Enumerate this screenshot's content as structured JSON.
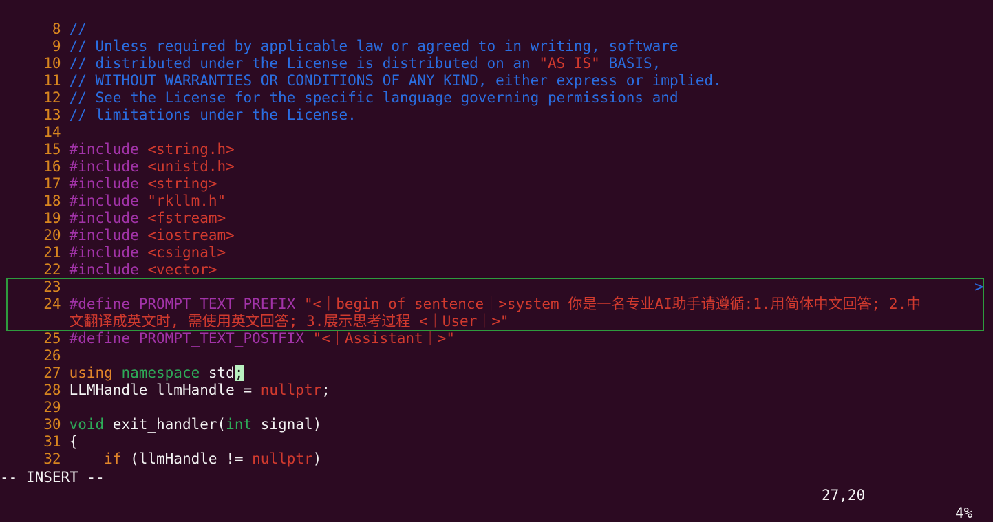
{
  "lines": [
    {
      "num": "8",
      "comment": "//"
    },
    {
      "num": "9",
      "comment": "// Unless required by applicable law or agreed to in writing, software"
    },
    {
      "num": "10",
      "comment_a": "// distributed under the License is distributed on an ",
      "comment_str": "\"AS IS\"",
      "comment_b": " BASIS,"
    },
    {
      "num": "11",
      "comment": "// WITHOUT WARRANTIES OR CONDITIONS OF ANY KIND, either express or implied."
    },
    {
      "num": "12",
      "comment": "// See the License for the specific language governing permissions and"
    },
    {
      "num": "13",
      "comment": "// limitations under the License."
    },
    {
      "num": "14"
    },
    {
      "num": "15",
      "directive": "#include",
      "target": "<string.h>"
    },
    {
      "num": "16",
      "directive": "#include",
      "target": "<unistd.h>"
    },
    {
      "num": "17",
      "directive": "#include",
      "target": "<string>"
    },
    {
      "num": "18",
      "directive": "#include",
      "target": "\"rkllm.h\""
    },
    {
      "num": "19",
      "directive": "#include",
      "target": "<fstream>"
    },
    {
      "num": "20",
      "directive": "#include",
      "target": "<iostream>"
    },
    {
      "num": "21",
      "directive": "#include",
      "target": "<csignal>"
    },
    {
      "num": "22",
      "directive": "#include",
      "target": "<vector>"
    },
    {
      "num": "23"
    },
    {
      "num": "24",
      "directive": "#define PROMPT_TEXT_PREFIX",
      "value": "\"<｜begin_of_sentence｜>system 你是一名专业AI助手请遵循:1.用简体中文回答; 2.中",
      "wrap_marker": ">",
      "value_cont": "文翻译成英文时, 需使用英文回答; 3.展示思考过程 <｜User｜>\""
    },
    {
      "num": "25",
      "directive": "#define PROMPT_TEXT_POSTFIX",
      "value": "\"<｜Assistant｜>\""
    },
    {
      "num": "26"
    },
    {
      "num": "27",
      "kw_using": "using",
      "kw_namespace": "namespace",
      "ident_before_cursor": "std",
      "cursor_char": ";"
    },
    {
      "num": "28",
      "text_a": "LLMHandle llmHandle = ",
      "nullptr": "nullptr",
      "text_b": ";"
    },
    {
      "num": "29"
    },
    {
      "num": "30",
      "kw_void": "void",
      "text_a": " exit_handler(",
      "kw_int": "int",
      "text_b": " signal)"
    },
    {
      "num": "31",
      "text": "{"
    },
    {
      "num": "32",
      "indent": "    ",
      "kw_if": "if",
      "text_a": " (llmHandle != ",
      "nullptr": "nullptr",
      "text_b": ")"
    }
  ],
  "status": {
    "mode": "-- INSERT --",
    "position": "27,20",
    "percent": "4%"
  }
}
